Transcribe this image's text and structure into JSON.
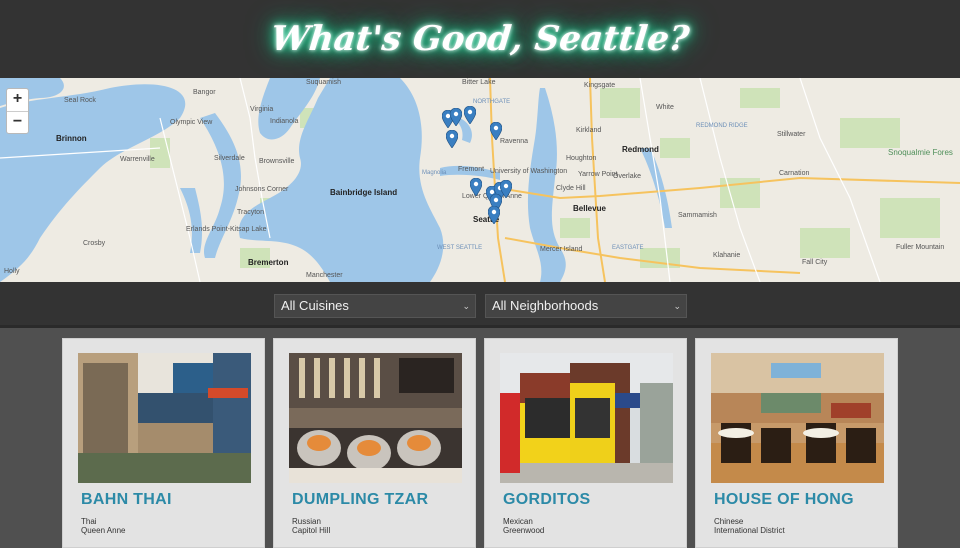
{
  "header": {
    "title": "What's Good, Seattle?"
  },
  "map": {
    "zoom_in": "+",
    "zoom_out": "−",
    "labels": [
      {
        "text": "Suquamish",
        "cls": ""
      },
      {
        "text": "Bitter Lake",
        "cls": ""
      },
      {
        "text": "Kingsgate",
        "cls": ""
      },
      {
        "text": "Bangor",
        "cls": ""
      },
      {
        "text": "Seal Rock",
        "cls": ""
      },
      {
        "text": "Olympic View",
        "cls": ""
      },
      {
        "text": "Brinnon",
        "cls": "big"
      },
      {
        "text": "Virginia",
        "cls": ""
      },
      {
        "text": "Indianola",
        "cls": ""
      },
      {
        "text": "NORTHGATE",
        "cls": "water"
      },
      {
        "text": "White",
        "cls": ""
      },
      {
        "text": "Kirkland",
        "cls": ""
      },
      {
        "text": "Redmond",
        "cls": "big"
      },
      {
        "text": "Stillwater",
        "cls": ""
      },
      {
        "text": "Snoqualmie Fores",
        "cls": "green"
      },
      {
        "text": "Warrenville",
        "cls": ""
      },
      {
        "text": "Silverdale",
        "cls": ""
      },
      {
        "text": "Brownsville",
        "cls": ""
      },
      {
        "text": "Ravenna",
        "cls": ""
      },
      {
        "text": "Houghton",
        "cls": ""
      },
      {
        "text": "Yarrow Point",
        "cls": ""
      },
      {
        "text": "Overlake",
        "cls": ""
      },
      {
        "text": "Carnation",
        "cls": ""
      },
      {
        "text": "Bainbridge Island",
        "cls": "big"
      },
      {
        "text": "Clyde Hill",
        "cls": ""
      },
      {
        "text": "Bellevue",
        "cls": "big"
      },
      {
        "text": "Johnsons Corner",
        "cls": ""
      },
      {
        "text": "Tracyton",
        "cls": ""
      },
      {
        "text": "Sammamish",
        "cls": ""
      },
      {
        "text": "Seattle",
        "cls": "big"
      },
      {
        "text": "Erlands Point-Kitsap Lake",
        "cls": ""
      },
      {
        "text": "Crosby",
        "cls": ""
      },
      {
        "text": "Mercer Island",
        "cls": ""
      },
      {
        "text": "Klahanie",
        "cls": ""
      },
      {
        "text": "Bremerton",
        "cls": "big"
      },
      {
        "text": "Manchester",
        "cls": ""
      },
      {
        "text": "Fall City",
        "cls": ""
      },
      {
        "text": "Fuller Mountain",
        "cls": ""
      },
      {
        "text": "Holly",
        "cls": ""
      },
      {
        "text": "Lower Queen Anne",
        "cls": ""
      },
      {
        "text": "Fremont",
        "cls": ""
      },
      {
        "text": "University of Washington",
        "cls": ""
      },
      {
        "text": "Magnolia",
        "cls": "water"
      },
      {
        "text": "EASTGATE",
        "cls": "water"
      },
      {
        "text": "WEST SEATTLE",
        "cls": "water"
      },
      {
        "text": "REDMOND RIDGE",
        "cls": "water"
      }
    ]
  },
  "filters": {
    "cuisine": "All Cuisines",
    "neighborhood": "All Neighborhoods"
  },
  "restaurants": [
    {
      "name": "BAHN THAI",
      "cuisine": "Thai",
      "neighborhood": "Queen Anne"
    },
    {
      "name": "DUMPLING TZAR",
      "cuisine": "Russian",
      "neighborhood": "Capitol Hill"
    },
    {
      "name": "GORDITOS",
      "cuisine": "Mexican",
      "neighborhood": "Greenwood"
    },
    {
      "name": "HOUSE OF HONG",
      "cuisine": "Chinese",
      "neighborhood": "International District"
    }
  ],
  "colors": {
    "accent": "#2c8aa7",
    "neon_glow": "#1fc98e",
    "water": "#9ec6e8",
    "land": "#eeebe3",
    "pin": "#3a7fc1"
  }
}
